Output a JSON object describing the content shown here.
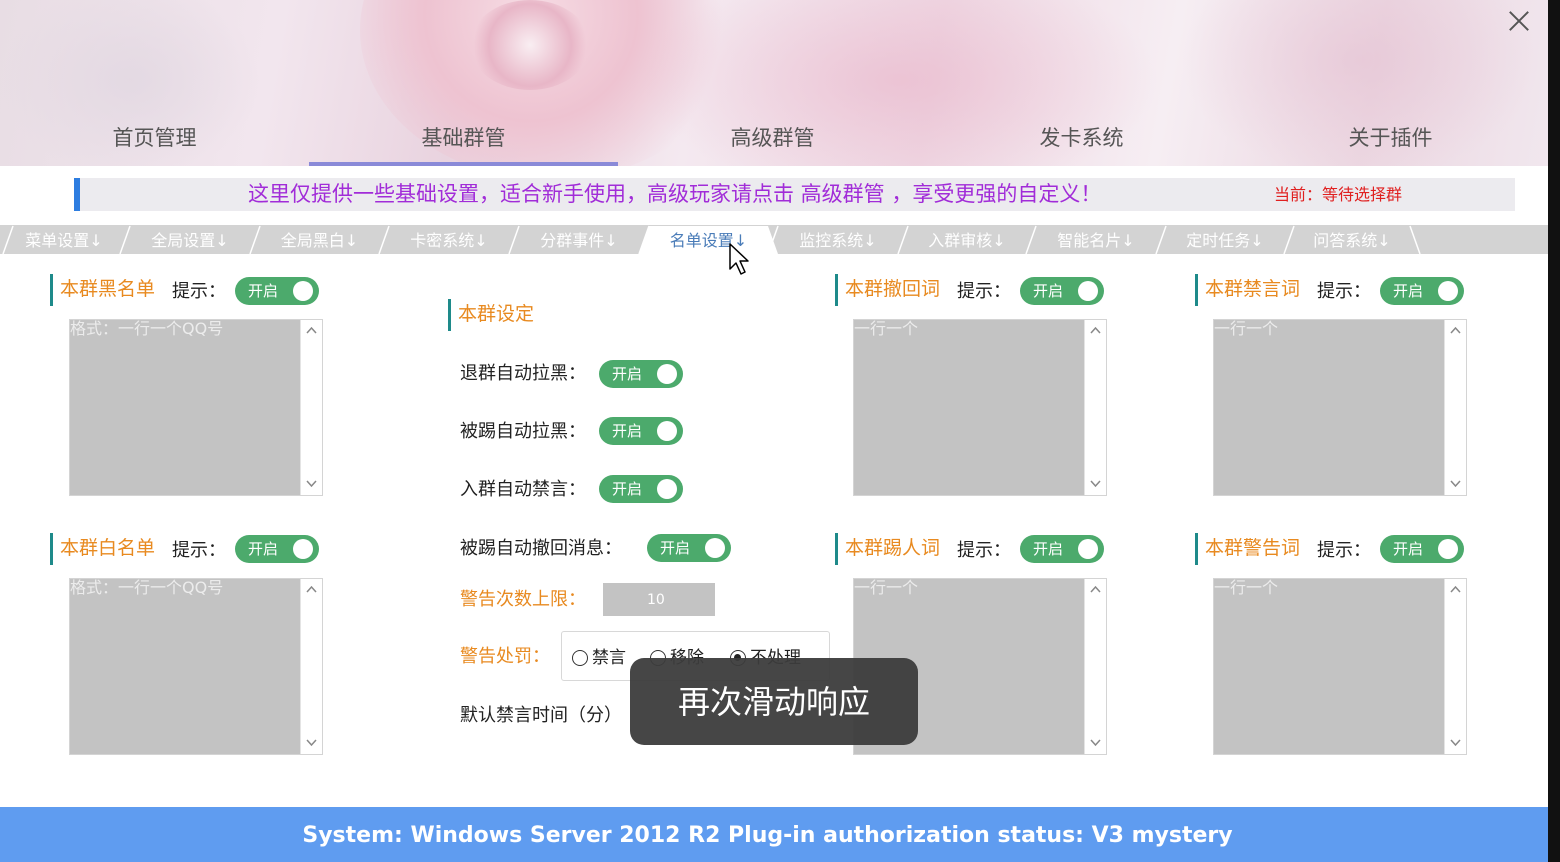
{
  "header": {
    "nav": [
      "首页管理",
      "基础群管",
      "高级群管",
      "发卡系统",
      "关于插件"
    ],
    "active_nav_index": 1
  },
  "notice": {
    "message": "这里仅提供一些基础设置，适合新手使用，高级玩家请点击 高级群管 ，享受更强的自定义！",
    "current_group": "当前：等待选择群"
  },
  "subtabs": {
    "items": [
      "菜单设置↓",
      "全局设置↓",
      "全局黑白↓",
      "卡密系统↓",
      "分群事件↓",
      "名单设置↓",
      "监控系统↓",
      "入群审核↓",
      "智能名片↓",
      "定时任务↓",
      "问答系统↓"
    ],
    "active_index": 5
  },
  "toggle_label": "开启",
  "hint_label": "提示：",
  "blacklist": {
    "title": "本群黑名单",
    "placeholder": "格式：一行一个QQ号"
  },
  "whitelist": {
    "title": "本群白名单",
    "placeholder": "格式：一行一个QQ号"
  },
  "recall_words": {
    "title": "本群撤回词",
    "placeholder": "一行一个"
  },
  "kick_words": {
    "title": "本群踢人词",
    "placeholder": "一行一个"
  },
  "ban_words": {
    "title": "本群禁言词",
    "placeholder": "一行一个"
  },
  "warn_words": {
    "title": "本群警告词",
    "placeholder": "一行一个"
  },
  "group_settings": {
    "title": "本群设定",
    "leave_blacklist": "退群自动拉黑：",
    "kick_blacklist": "被踢自动拉黑：",
    "join_mute": "入群自动禁言：",
    "kick_recall": "被踢自动撤回消息：",
    "warn_limit_label": "警告次数上限：",
    "warn_limit_value": "10",
    "warn_penalty_label": "警告处罚：",
    "penalty_options": [
      "禁言",
      "移除",
      "不处理"
    ],
    "penalty_selected_index": 2,
    "default_mute_label": "默认禁言时间（分）"
  },
  "toast": "再次滑动响应",
  "footer": "System:  Windows Server 2012 R2  Plug-in authorization status:  V3 mystery",
  "colors": {
    "accent_blue": "#5f9cf0",
    "toggle_green": "#4caa6c",
    "title_orange": "#e88a20",
    "notice_purple": "#a12cd8",
    "notice_red": "#e02020"
  }
}
